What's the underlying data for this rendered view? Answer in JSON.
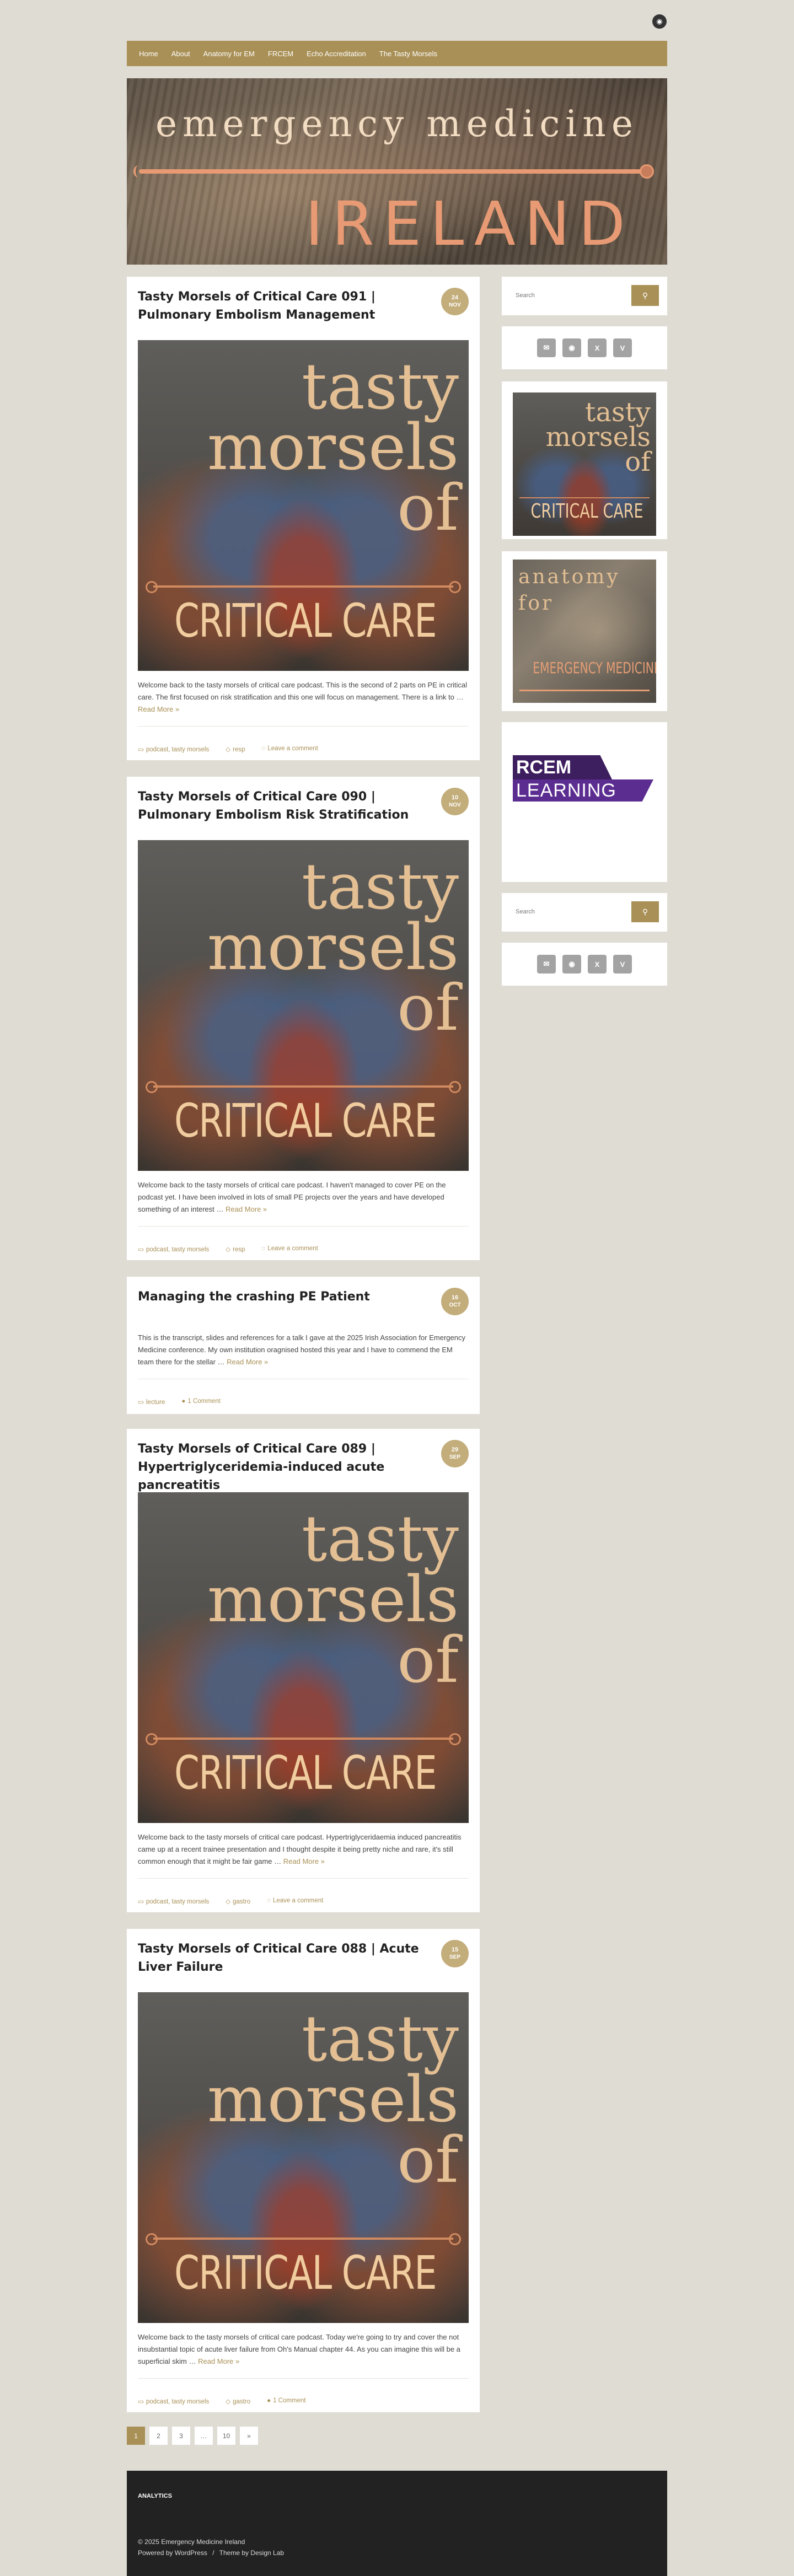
{
  "top_social": {
    "icon": "rss-icon",
    "glyph": "◉"
  },
  "nav": {
    "items": [
      "Home",
      "About",
      "Anatomy for EM",
      "FRCEM",
      "Echo Accreditation",
      "The Tasty Morsels"
    ]
  },
  "banner": {
    "line1": "emergency medicine",
    "line2": "IRELAND"
  },
  "thumb": {
    "line1": "tasty",
    "line2": "morsels",
    "line3": "of",
    "line4": "CRITICAL CARE"
  },
  "posts": [
    {
      "title": "Tasty Morsels of Critical Care 091 | Pulmonary Embolism Management",
      "day": "24",
      "month": "NOV",
      "excerpt": "Welcome back to the tasty morsels of critical care podcast. This is the second of 2 parts on PE in critical care. The first focused on risk stratification and this one will focus on management. There is a link to …",
      "more": "Read More »",
      "categories": "podcast, tasty morsels",
      "tags": "resp",
      "comments": "Leave a comment"
    },
    {
      "title": "Tasty Morsels of Critical Care 090 | Pulmonary Embolism Risk Stratification",
      "day": "10",
      "month": "NOV",
      "excerpt": "Welcome back to the tasty morsels of critical care podcast. I haven't managed to cover PE on the podcast yet. I have been involved in lots of small PE projects over the years and have developed something of an interest …",
      "more": "Read More »",
      "categories": "podcast, tasty morsels",
      "tags": "resp",
      "comments": "Leave a comment"
    },
    {
      "title": "Managing the crashing PE Patient",
      "day": "16",
      "month": "OCT",
      "excerpt": "This is the transcript, slides and references for a talk I gave at the 2025 Irish Association for Emergency Medicine conference. My own institution oragnised hosted this year and I have to commend the EM team there for the stellar …",
      "more": "Read More »",
      "categories": "lecture",
      "comments": "1 Comment"
    },
    {
      "title": "Tasty Morsels of Critical Care 089 | Hypertriglyceridemia-induced acute pancreatitis",
      "day": "29",
      "month": "SEP",
      "excerpt": "Welcome back to the tasty morsels of critical care podcast. Hypertriglyceridaemia induced pancreatitis came up at a recent trainee presentation and I thought despite it being pretty niche and rare, it's still common enough that it might be fair game …",
      "more": "Read More »",
      "categories": "podcast, tasty morsels",
      "tags": "gastro",
      "comments": "Leave a comment"
    },
    {
      "title": "Tasty Morsels of Critical Care 088 | Acute Liver Failure",
      "day": "15",
      "month": "SEP",
      "excerpt": "Welcome back to the tasty morsels of critical care podcast. Today we're going to try and cover the not insubstantial topic of acute liver failure from Oh's Manual chapter 44. As you can imagine this will be a superficial skim …",
      "more": "Read More »",
      "categories": "podcast, tasty morsels",
      "tags": "gastro",
      "comments": "1 Comment"
    }
  ],
  "sidebar": {
    "search_placeholder": "Search",
    "search_icon": "search-icon",
    "social_icons": [
      "mail-icon",
      "rss-icon",
      "x-icon",
      "vimeo-icon"
    ],
    "social_glyphs": [
      "✉",
      "◉",
      "X",
      "V"
    ],
    "tasty_image": {
      "line1": "tasty",
      "line2": "morsels",
      "line3": "of",
      "line4": "CRITICAL CARE"
    },
    "anatomy_image": {
      "line1": "anatomy",
      "line2": "for",
      "line3": "EMERGENCY MEDICINE"
    },
    "rcem": {
      "line1": "RCEM",
      "line2": "LEARNING"
    }
  },
  "pagination": [
    "1",
    "2",
    "3",
    "…",
    "10",
    "»"
  ],
  "footer": {
    "analytics": "ANALYTICS",
    "copyright": "© 2025 Emergency Medicine Ireland",
    "powered": "Powered by WordPress",
    "separator": "/",
    "theme": "Theme by Design Lab"
  },
  "colors": {
    "accent": "#a99056",
    "badge": "#c3ad7b",
    "background": "#dfdcd4",
    "footer": "#222222"
  }
}
